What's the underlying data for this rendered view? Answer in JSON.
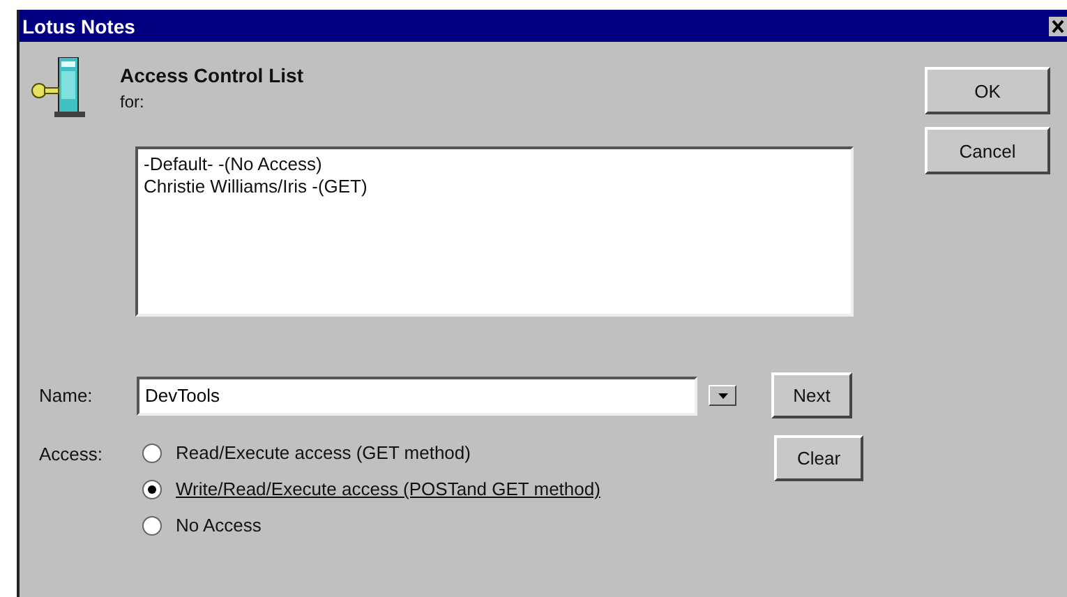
{
  "window": {
    "title": "Lotus Notes"
  },
  "header": {
    "title": "Access Control List",
    "subtitle": "for:"
  },
  "acl_list": [
    "-Default- -(No Access)",
    "Christie Williams/Iris -(GET)"
  ],
  "name_field": {
    "label": "Name:",
    "value": "DevTools"
  },
  "access": {
    "label": "Access:",
    "options": [
      {
        "label": "Read/Execute access (GET method)",
        "selected": false
      },
      {
        "label": "Write/Read/Execute access (POSTand GET method)",
        "selected": true
      },
      {
        "label": "No Access",
        "selected": false
      }
    ]
  },
  "side_buttons": [
    "Next",
    "Clear"
  ],
  "buttons": [
    "OK",
    "Cancel"
  ]
}
